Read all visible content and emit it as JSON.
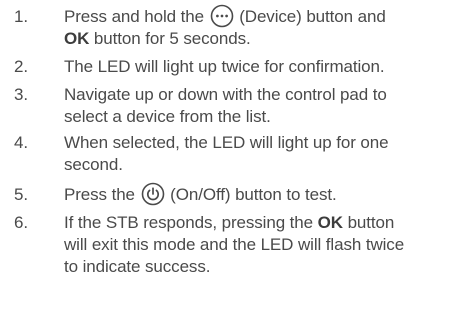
{
  "steps": [
    {
      "number": "1.",
      "parts": [
        {
          "t": "text",
          "v": "Press and hold the "
        },
        {
          "t": "icon",
          "v": "device-button-icon"
        },
        {
          "t": "text",
          "v": " (Device) button and"
        },
        {
          "t": "br"
        },
        {
          "t": "bold",
          "v": "OK"
        },
        {
          "t": "text",
          "v": " button for 5 seconds."
        }
      ]
    },
    {
      "number": "2.",
      "parts": [
        {
          "t": "text",
          "v": "The LED will light up twice for confirmation."
        }
      ]
    },
    {
      "number": "3.",
      "parts": [
        {
          "t": "text",
          "v": "Navigate up or down with the control pad to"
        },
        {
          "t": "br"
        },
        {
          "t": "text",
          "v": "select a device from the list."
        }
      ]
    },
    {
      "number": "4.",
      "parts": [
        {
          "t": "text",
          "v": "When selected, the LED will light up for one"
        },
        {
          "t": "br"
        },
        {
          "t": "text",
          "v": "second."
        }
      ]
    },
    {
      "number": "5.",
      "parts": [
        {
          "t": "text",
          "v": "Press the "
        },
        {
          "t": "icon",
          "v": "power-button-icon"
        },
        {
          "t": "text",
          "v": " (On/Off) button to test."
        }
      ]
    },
    {
      "number": "6.",
      "parts": [
        {
          "t": "text",
          "v": "If the STB responds, pressing the "
        },
        {
          "t": "bold",
          "v": "OK"
        },
        {
          "t": "text",
          "v": " button"
        },
        {
          "t": "br"
        },
        {
          "t": "text",
          "v": "will exit this mode and the LED will flash twice"
        },
        {
          "t": "br"
        },
        {
          "t": "text",
          "v": "to indicate success."
        }
      ]
    }
  ]
}
